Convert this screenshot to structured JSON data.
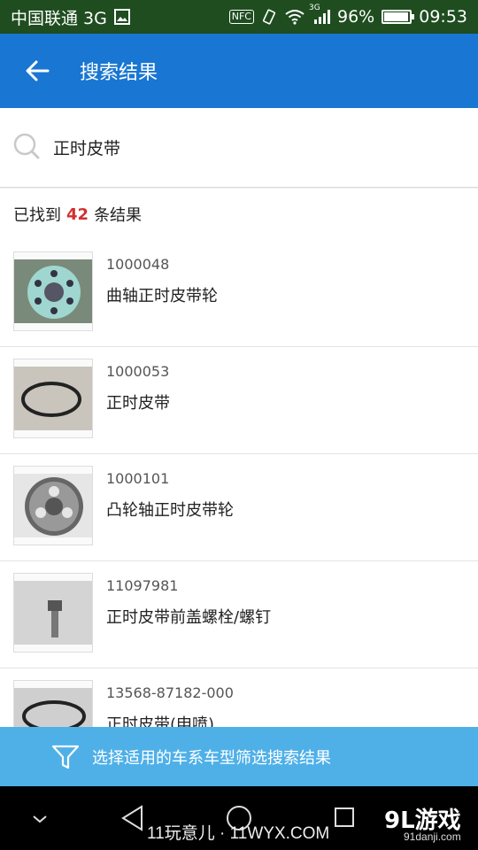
{
  "status_bar": {
    "carrier": "中国联通 3G",
    "nfc_label": "NFC",
    "network_type": "3G",
    "battery": "96%",
    "battery_level": 0.96,
    "time": "09:53"
  },
  "header": {
    "title": "搜索结果"
  },
  "search": {
    "query": "正时皮带"
  },
  "results_summary": {
    "prefix": "已找到",
    "count": "42",
    "suffix": "条结果"
  },
  "results": [
    {
      "code": "1000048",
      "name": "曲轴正时皮带轮",
      "thumb_icon": "sprocket-wheel"
    },
    {
      "code": "1000053",
      "name": "正时皮带",
      "thumb_icon": "belt-loop"
    },
    {
      "code": "1000101",
      "name": "凸轮轴正时皮带轮",
      "thumb_icon": "toothed-pulley"
    },
    {
      "code": "11097981",
      "name": "正时皮带前盖螺栓/螺钉",
      "thumb_icon": "bolt"
    },
    {
      "code": "13568-87182-000",
      "name": "正时皮带(申喷)",
      "thumb_icon": "belt-loop"
    }
  ],
  "filter_bar": {
    "label": "选择适用的车系车型筛选搜索结果"
  },
  "watermark": {
    "left": "11玩意儿 · 11WYX.COM",
    "right_logo": "9L游戏",
    "right_url": "91danji.com"
  }
}
